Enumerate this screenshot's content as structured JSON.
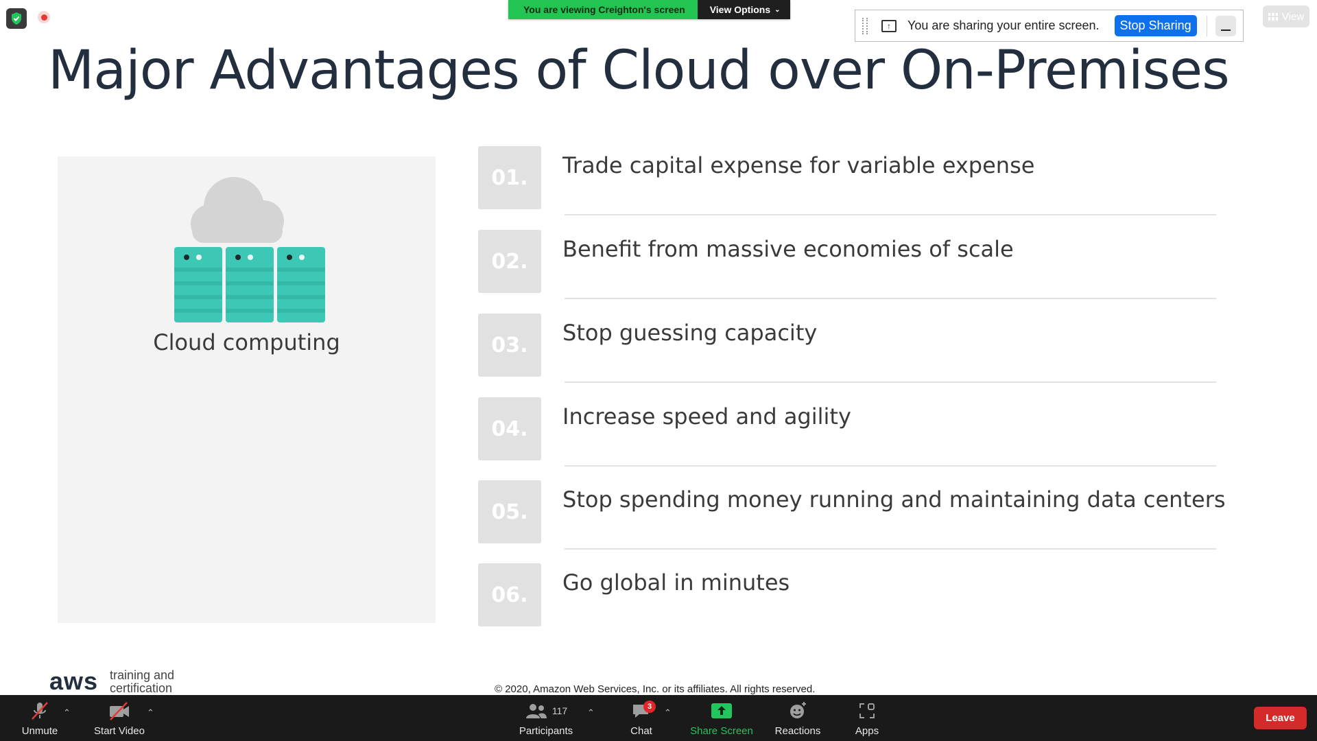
{
  "meeting": {
    "viewing_banner": "You are viewing Creighton's screen",
    "view_options": "View Options",
    "sharing_message": "You are sharing your entire screen.",
    "stop_sharing": "Stop Sharing",
    "view_button": "View"
  },
  "slide": {
    "title": "Major Advantages of Cloud over On-Premises",
    "panel_label": "Cloud computing",
    "items": [
      {
        "num": "01.",
        "text": "Trade capital expense for variable expense"
      },
      {
        "num": "02.",
        "text": "Benefit from massive economies of scale"
      },
      {
        "num": "03.",
        "text": "Stop guessing capacity"
      },
      {
        "num": "04.",
        "text": "Increase speed and agility"
      },
      {
        "num": "05.",
        "text": "Stop spending money running and maintaining data centers"
      },
      {
        "num": "06.",
        "text": "Go global in minutes"
      }
    ],
    "logo_mark": "aws",
    "logo_sub": "training and certification",
    "copyright": "© 2020, Amazon Web Services, Inc. or its affiliates. All rights reserved."
  },
  "toolbar": {
    "unmute": "Unmute",
    "start_video": "Start Video",
    "participants": "Participants",
    "participant_count": "117",
    "chat": "Chat",
    "chat_badge": "3",
    "share_screen": "Share Screen",
    "reactions": "Reactions",
    "apps": "Apps",
    "leave": "Leave"
  },
  "colors": {
    "accent_green": "#23c552",
    "share_blue": "#0e71eb",
    "leave_red": "#d42a2a",
    "server_teal": "#3cc8b4",
    "title_navy": "#232f3e"
  },
  "icons": [
    "shield-check-icon",
    "record-icon",
    "share-up-icon",
    "grid-icon",
    "muted-mic-icon",
    "video-off-icon",
    "participants-icon",
    "chat-icon",
    "share-screen-icon",
    "reactions-icon",
    "apps-icon",
    "chevron-up-icon"
  ]
}
